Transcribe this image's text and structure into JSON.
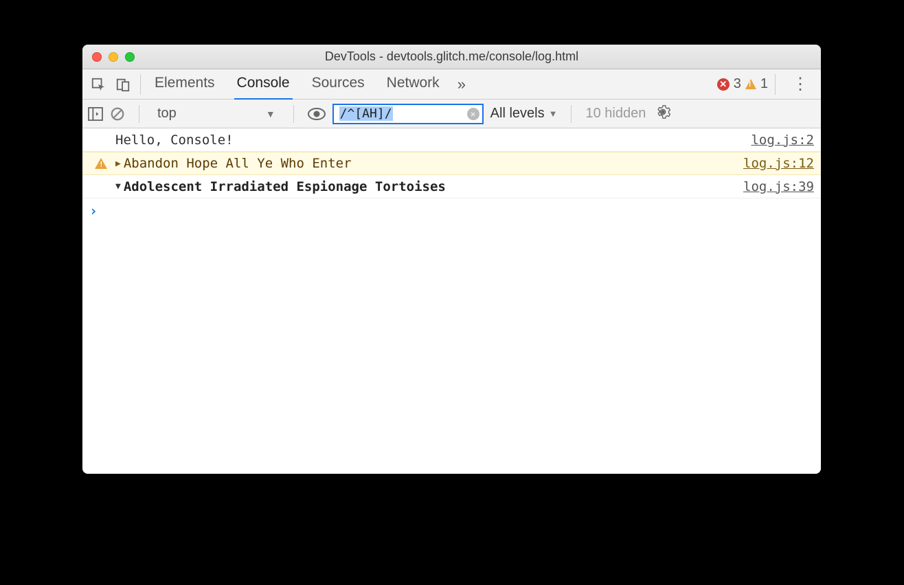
{
  "window": {
    "title": "DevTools - devtools.glitch.me/console/log.html"
  },
  "tabs": {
    "items": [
      "Elements",
      "Console",
      "Sources",
      "Network"
    ],
    "active": "Console"
  },
  "counters": {
    "errors": "3",
    "warnings": "1"
  },
  "filterbar": {
    "context": "top",
    "filter_value": "/^[AH]/",
    "levels_label": "All levels",
    "hidden_label": "10 hidden"
  },
  "messages": [
    {
      "type": "log",
      "text": "Hello, Console!",
      "src": "log.js:2"
    },
    {
      "type": "warn",
      "text": "Abandon Hope All Ye Who Enter",
      "src": "log.js:12",
      "expand": "▶"
    },
    {
      "type": "group",
      "text": "Adolescent Irradiated Espionage Tortoises",
      "src": "log.js:39",
      "expand": "▼"
    }
  ],
  "prompt": "›"
}
